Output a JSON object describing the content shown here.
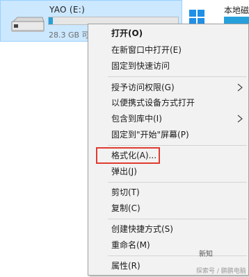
{
  "drive": {
    "name": "YAO (E:)",
    "free_text": "28.3 GB 可",
    "usage_fraction": 0.03,
    "bar_color": "#26a0da",
    "tile_color": "#cce8ff"
  },
  "neighbor": {
    "name": "本地磁",
    "icon": "windows-logo-icon"
  },
  "menu": {
    "items": [
      {
        "label": "打开(O)",
        "bold": true
      },
      {
        "label": "在新窗口中打开(E)"
      },
      {
        "label": "固定到快速访问"
      },
      {
        "label": "授予访问权限(G)",
        "submenu": true
      },
      {
        "label": "以便携式设备方式打开"
      },
      {
        "label": "包含到库中(I)",
        "submenu": true
      },
      {
        "label": "固定到\"开始\"屏幕(P)"
      },
      {
        "label": "格式化(A)...",
        "highlighted": true
      },
      {
        "label": "弹出(J)"
      },
      {
        "label": "剪切(T)"
      },
      {
        "label": "复制(C)"
      },
      {
        "label": "创建快捷方式(S)"
      },
      {
        "label": "重命名(M)"
      },
      {
        "label": "属性(R)"
      }
    ],
    "highlight_color": "#e03a2f"
  },
  "watermark": {
    "logo_text": "新知",
    "caption": "探索号 / 鹏鹏电脑"
  }
}
